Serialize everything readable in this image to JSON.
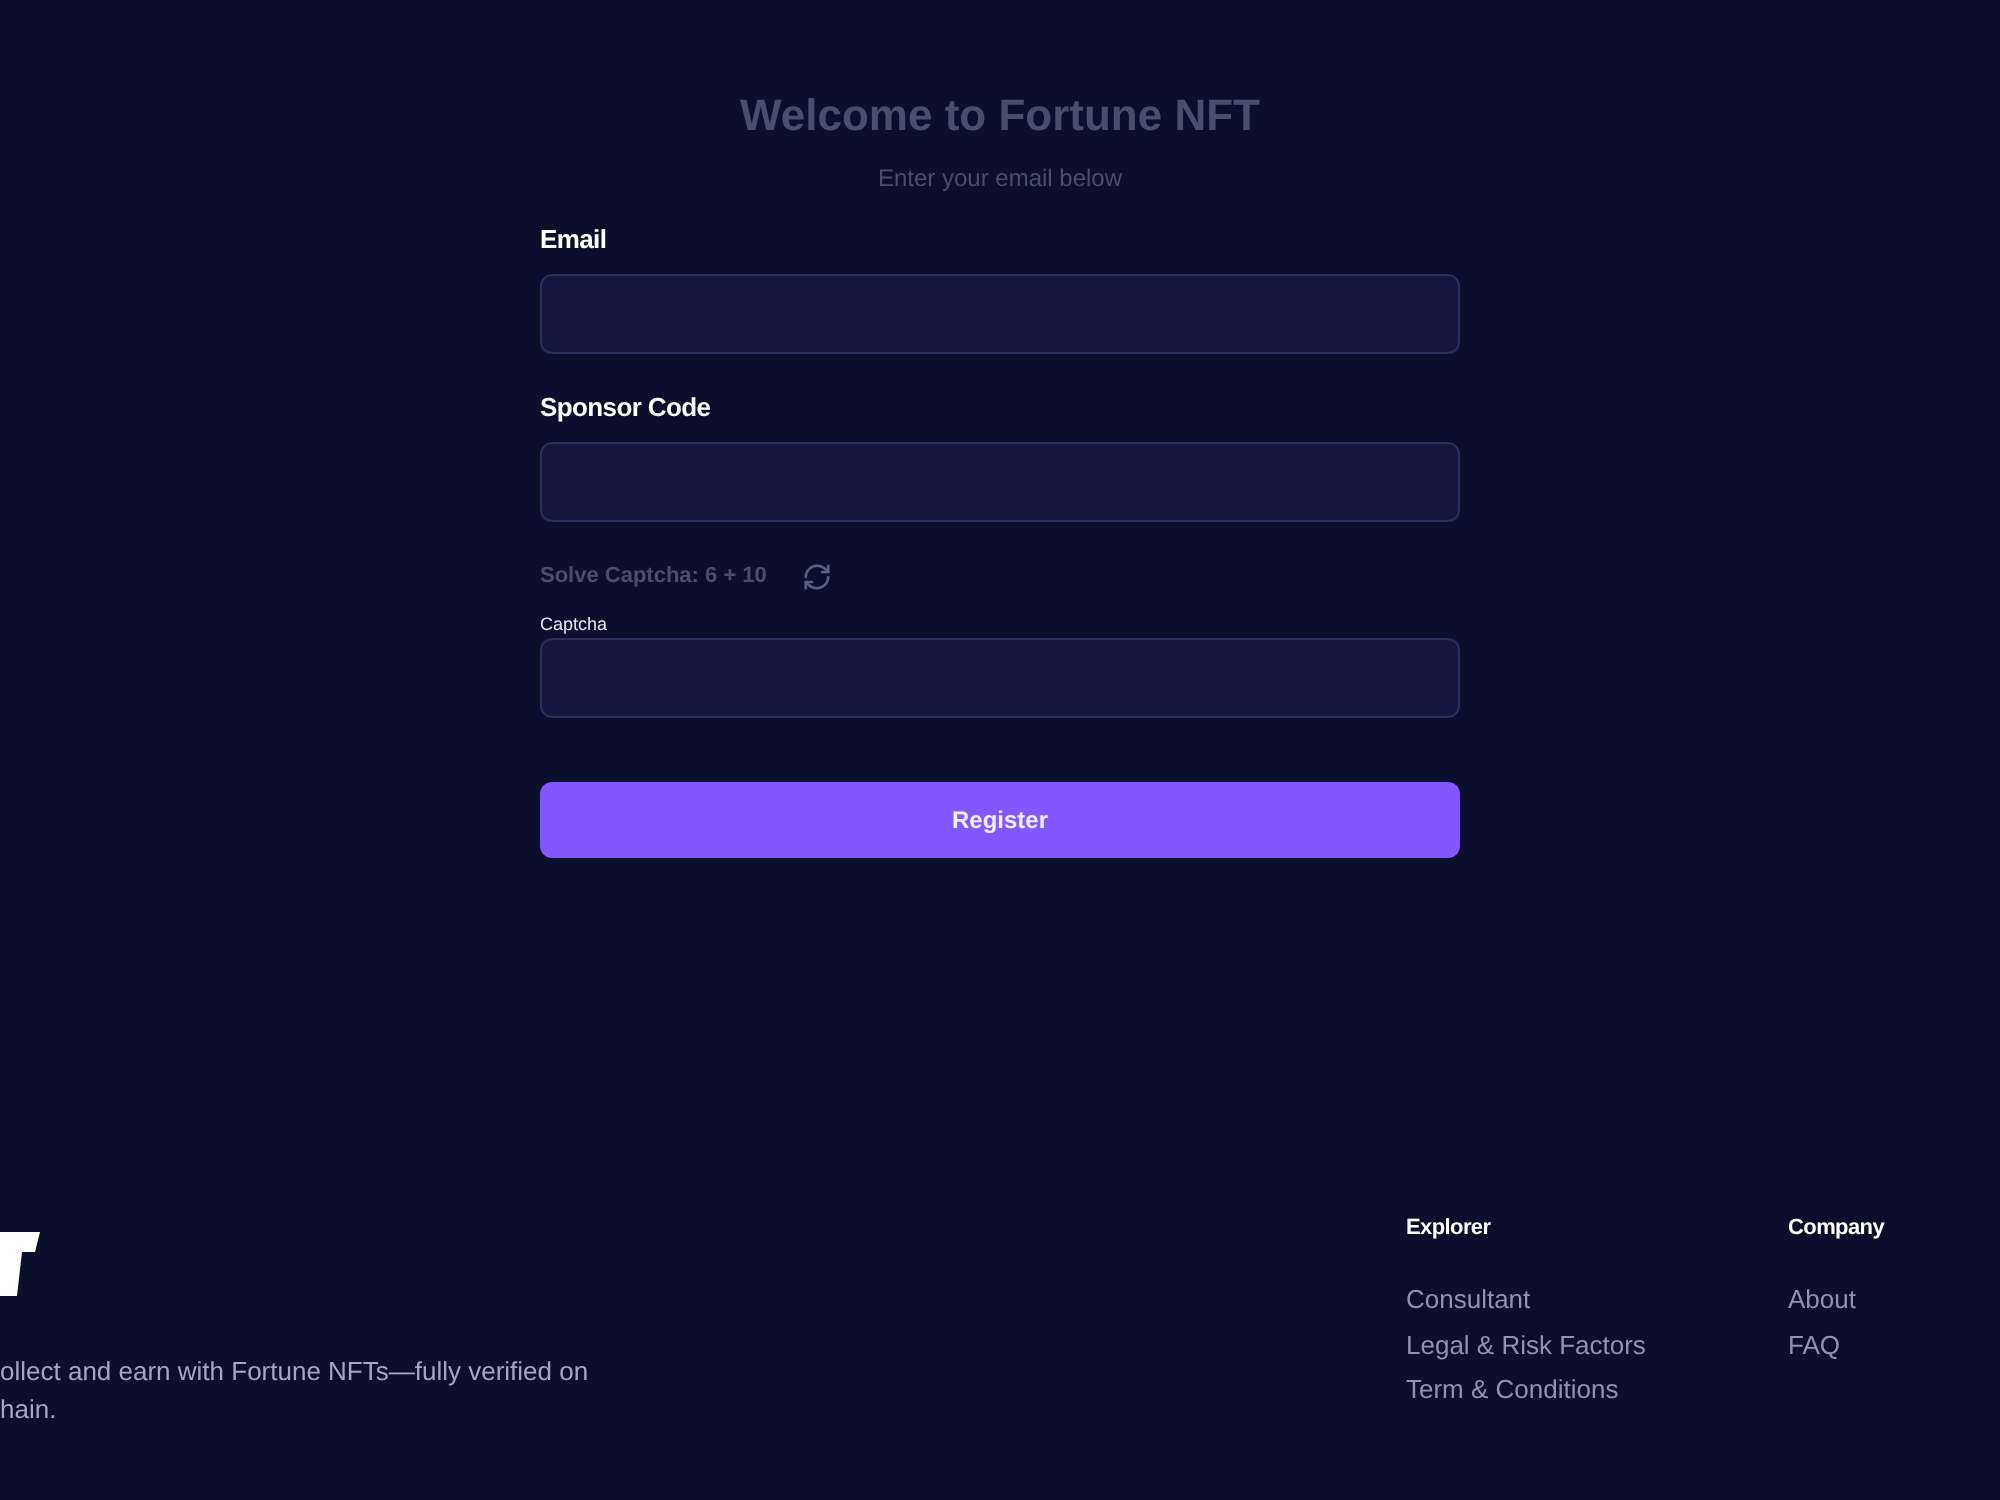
{
  "header": {
    "title": "Welcome to Fortune NFT",
    "subtitle": "Enter your email below"
  },
  "form": {
    "email": {
      "label": "Email"
    },
    "sponsor_code": {
      "label": "Sponsor Code"
    },
    "captcha": {
      "prompt": "Solve Captcha: 6 + 10",
      "label": "Captcha"
    },
    "submit": {
      "label": "Register"
    }
  },
  "footer": {
    "description_lines": [
      "ollect and earn with Fortune NFTs—fully verified on",
      "hain."
    ],
    "columns": [
      {
        "heading": "Explorer",
        "links": [
          "Consultant",
          "Legal & Risk Factors",
          "Term & Conditions"
        ]
      },
      {
        "heading": "Company",
        "links": [
          "About",
          "FAQ"
        ]
      }
    ]
  }
}
